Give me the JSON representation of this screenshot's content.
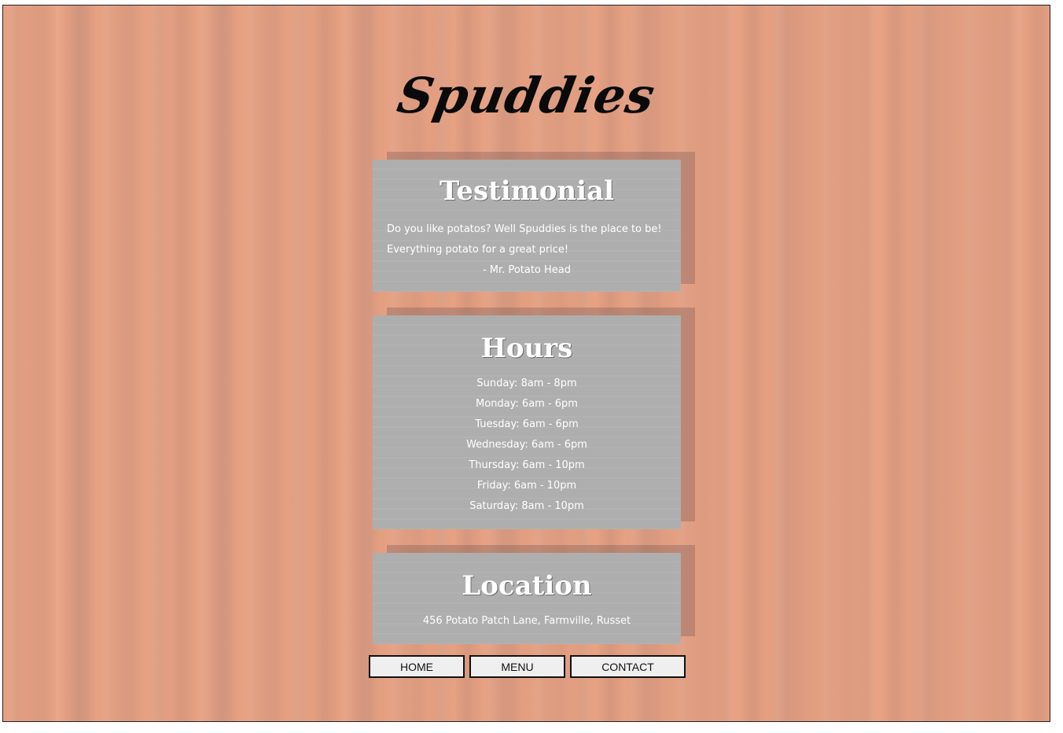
{
  "brand": {
    "title": "Spuddies"
  },
  "testimonial": {
    "heading": "Testimonial",
    "quote": "Do you like potatos? Well Spuddies is the place to be! Everything potato for a great price!",
    "author": "- Mr. Potato Head"
  },
  "hours": {
    "heading": "Hours",
    "items": [
      "Sunday: 8am - 8pm",
      "Monday: 6am - 6pm",
      "Tuesday: 6am - 6pm",
      "Wednesday: 6am - 6pm",
      "Thursday: 6am - 10pm",
      "Friday: 6am - 10pm",
      "Saturday: 8am - 10pm"
    ]
  },
  "location": {
    "heading": "Location",
    "address": "456 Potato Patch Lane, Farmville, Russet"
  },
  "nav": {
    "home": "HOME",
    "menu": "MENU",
    "contact": "CONTACT"
  }
}
